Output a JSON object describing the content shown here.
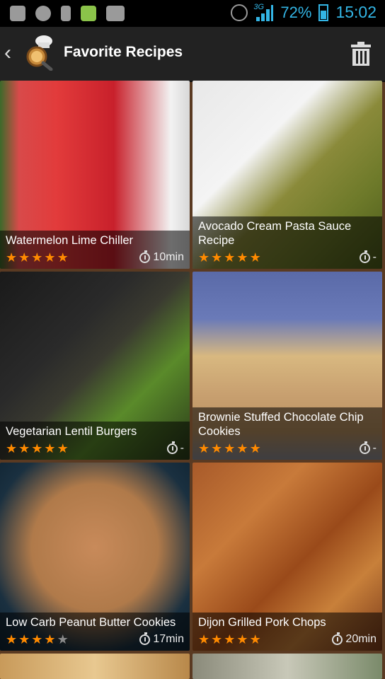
{
  "status_bar": {
    "network": "3G",
    "battery": "72%",
    "time": "15:02"
  },
  "header": {
    "title": "Favorite Recipes"
  },
  "recipes": [
    {
      "title": "Watermelon Lime Chiller",
      "rating": 5,
      "time": "10min"
    },
    {
      "title": "Avocado Cream Pasta Sauce Recipe",
      "rating": 5,
      "time": "-"
    },
    {
      "title": "Vegetarian Lentil Burgers",
      "rating": 5,
      "time": "-"
    },
    {
      "title": "Brownie Stuffed Chocolate Chip Cookies",
      "rating": 5,
      "time": "-"
    },
    {
      "title": "Low Carb Peanut Butter Cookies",
      "rating": 4,
      "time": "17min"
    },
    {
      "title": "Dijon Grilled Pork Chops",
      "rating": 5,
      "time": "20min"
    }
  ],
  "colors": {
    "star_on": "#ff8a00",
    "star_off": "#8a8a8a",
    "accent": "#33b5e5"
  }
}
